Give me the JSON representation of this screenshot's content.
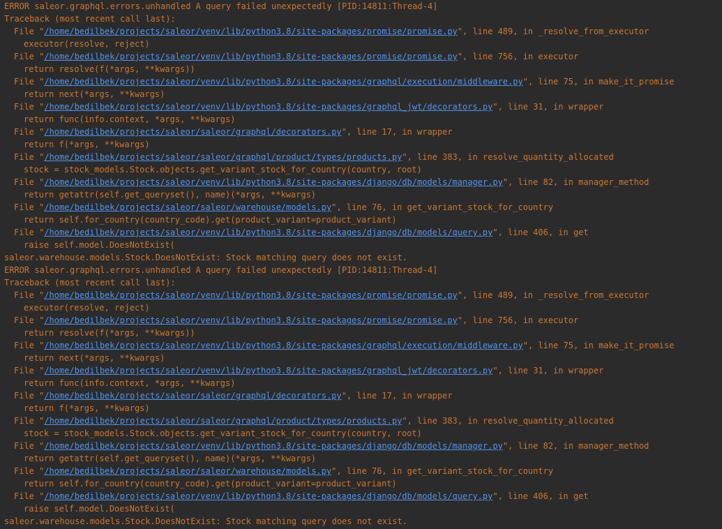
{
  "colors": {
    "background": "#2b2b2b",
    "error_text": "#cc7832",
    "link": "#5394ec"
  },
  "blocks": [
    {
      "header": "ERROR saleor.graphql.errors.unhandled A query failed unexpectedly [PID:14811:Thread-4]",
      "traceback_label": "Traceback (most recent call last):",
      "frames": [
        {
          "prefix": "File \"",
          "path": "/home/bedilbek/projects/saleor/venv/lib/python3.8/site-packages/promise/promise.py",
          "suffix": "\", line 489, in _resolve_from_executor",
          "code": "executor(resolve, reject)"
        },
        {
          "prefix": "File \"",
          "path": "/home/bedilbek/projects/saleor/venv/lib/python3.8/site-packages/promise/promise.py",
          "suffix": "\", line 756, in executor",
          "code": "return resolve(f(*args, **kwargs))"
        },
        {
          "prefix": "File \"",
          "path": "/home/bedilbek/projects/saleor/venv/lib/python3.8/site-packages/graphql/execution/middleware.py",
          "suffix": "\", line 75, in make_it_promise",
          "code": "return next(*args, **kwargs)"
        },
        {
          "prefix": "File \"",
          "path": "/home/bedilbek/projects/saleor/venv/lib/python3.8/site-packages/graphql_jwt/decorators.py",
          "suffix": "\", line 31, in wrapper",
          "code": "return func(info.context, *args, **kwargs)"
        },
        {
          "prefix": "File \"",
          "path": "/home/bedilbek/projects/saleor/saleor/graphql/decorators.py",
          "suffix": "\", line 17, in wrapper",
          "code": "return f(*args, **kwargs)"
        },
        {
          "prefix": "File \"",
          "path": "/home/bedilbek/projects/saleor/saleor/graphql/product/types/products.py",
          "suffix": "\", line 383, in resolve_quantity_allocated",
          "code": "stock = stock_models.Stock.objects.get_variant_stock_for_country(country, root)"
        },
        {
          "prefix": "File \"",
          "path": "/home/bedilbek/projects/saleor/venv/lib/python3.8/site-packages/django/db/models/manager.py",
          "suffix": "\", line 82, in manager_method",
          "code": "return getattr(self.get_queryset(), name)(*args, **kwargs)"
        },
        {
          "prefix": "File \"",
          "path": "/home/bedilbek/projects/saleor/saleor/warehouse/models.py",
          "suffix": "\", line 76, in get_variant_stock_for_country",
          "code": "return self.for_country(country_code).get(product_variant=product_variant)"
        },
        {
          "prefix": "File \"",
          "path": "/home/bedilbek/projects/saleor/venv/lib/python3.8/site-packages/django/db/models/query.py",
          "suffix": "\", line 406, in get",
          "code": "raise self.model.DoesNotExist("
        }
      ],
      "exception": "saleor.warehouse.models.Stock.DoesNotExist: Stock matching query does not exist."
    },
    {
      "header": "ERROR saleor.graphql.errors.unhandled A query failed unexpectedly [PID:14811:Thread-4]",
      "traceback_label": "Traceback (most recent call last):",
      "frames": [
        {
          "prefix": "File \"",
          "path": "/home/bedilbek/projects/saleor/venv/lib/python3.8/site-packages/promise/promise.py",
          "suffix": "\", line 489, in _resolve_from_executor",
          "code": "executor(resolve, reject)"
        },
        {
          "prefix": "File \"",
          "path": "/home/bedilbek/projects/saleor/venv/lib/python3.8/site-packages/promise/promise.py",
          "suffix": "\", line 756, in executor",
          "code": "return resolve(f(*args, **kwargs))"
        },
        {
          "prefix": "File \"",
          "path": "/home/bedilbek/projects/saleor/venv/lib/python3.8/site-packages/graphql/execution/middleware.py",
          "suffix": "\", line 75, in make_it_promise",
          "code": "return next(*args, **kwargs)"
        },
        {
          "prefix": "File \"",
          "path": "/home/bedilbek/projects/saleor/venv/lib/python3.8/site-packages/graphql_jwt/decorators.py",
          "suffix": "\", line 31, in wrapper",
          "code": "return func(info.context, *args, **kwargs)"
        },
        {
          "prefix": "File \"",
          "path": "/home/bedilbek/projects/saleor/saleor/graphql/decorators.py",
          "suffix": "\", line 17, in wrapper",
          "code": "return f(*args, **kwargs)"
        },
        {
          "prefix": "File \"",
          "path": "/home/bedilbek/projects/saleor/saleor/graphql/product/types/products.py",
          "suffix": "\", line 383, in resolve_quantity_allocated",
          "code": "stock = stock_models.Stock.objects.get_variant_stock_for_country(country, root)"
        },
        {
          "prefix": "File \"",
          "path": "/home/bedilbek/projects/saleor/venv/lib/python3.8/site-packages/django/db/models/manager.py",
          "suffix": "\", line 82, in manager_method",
          "code": "return getattr(self.get_queryset(), name)(*args, **kwargs)"
        },
        {
          "prefix": "File \"",
          "path": "/home/bedilbek/projects/saleor/saleor/warehouse/models.py",
          "suffix": "\", line 76, in get_variant_stock_for_country",
          "code": "return self.for_country(country_code).get(product_variant=product_variant)"
        },
        {
          "prefix": "File \"",
          "path": "/home/bedilbek/projects/saleor/venv/lib/python3.8/site-packages/django/db/models/query.py",
          "suffix": "\", line 406, in get",
          "code": "raise self.model.DoesNotExist("
        }
      ],
      "exception": "saleor.warehouse.models.Stock.DoesNotExist: Stock matching query does not exist."
    }
  ]
}
